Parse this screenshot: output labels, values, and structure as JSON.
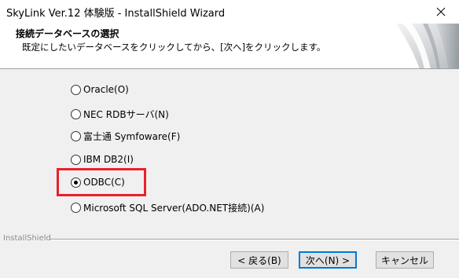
{
  "window": {
    "title": "SkyLink Ver.12 体験版 - InstallShield Wizard"
  },
  "header": {
    "title": "接続データベースの選択",
    "subtitle": "既定にしたいデータベースをクリックしてから、[次へ]をクリックします。"
  },
  "options": [
    {
      "label": "Oracle(O)",
      "checked": false
    },
    {
      "label": "NEC RDBサーバ(N)",
      "checked": false
    },
    {
      "label": "富士通 Symfoware(F)",
      "checked": false
    },
    {
      "label": "IBM DB2(I)",
      "checked": false
    },
    {
      "label": "ODBC(C)",
      "checked": true
    },
    {
      "label": "Microsoft SQL Server(ADO.NET接続)(A)",
      "checked": false
    }
  ],
  "footer": {
    "brand": "InstallShield",
    "back_label": "< 戻る(B)",
    "next_label": "次へ(N) >",
    "cancel_label": "キャンセル"
  },
  "colors": {
    "highlight": "#e8222a",
    "accent": "#0078d7"
  }
}
